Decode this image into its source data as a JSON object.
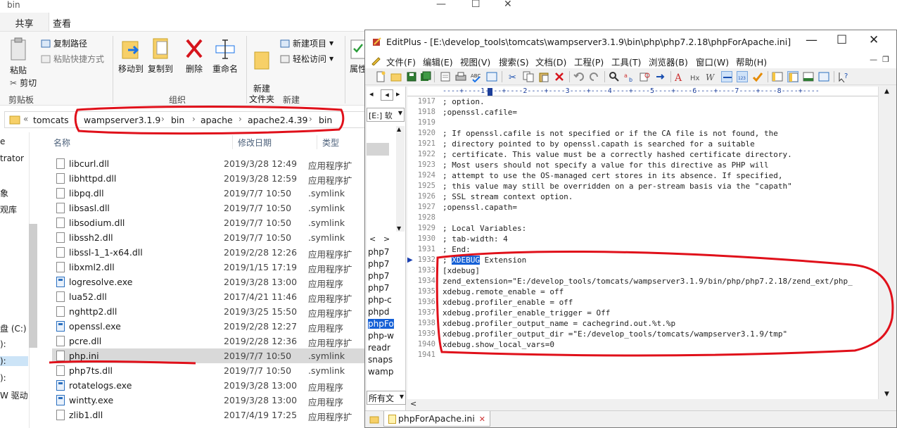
{
  "explorer": {
    "title": "bin",
    "ribbon_tabs": [
      "共享",
      "查看"
    ],
    "ribbon": {
      "paste": "粘贴",
      "copy_path": "复制路径",
      "paste_shortcut": "粘贴快捷方式",
      "cut": "剪切",
      "clipboard_group": "剪贴板",
      "move_to": "移动到",
      "copy_to": "复制到",
      "delete": "删除",
      "rename": "重命名",
      "organize_group": "组织",
      "new_folder": "新建\n文件夹",
      "new_item": "新建项目",
      "easy_access": "轻松访问",
      "new_group": "新建",
      "properties": "属性"
    },
    "breadcrumb": [
      "tomcats",
      "wampserver3.1.9",
      "bin",
      "apache",
      "apache2.4.39",
      "bin"
    ],
    "nav_items": [
      "e",
      "trator",
      "象",
      "观库",
      "盘 (C:)",
      "):",
      "):",
      "):",
      "W 驱动"
    ],
    "columns": {
      "name": "名称",
      "date": "修改日期",
      "type": "类型"
    },
    "files": [
      {
        "name": "libcurl.dll",
        "date": "2019/3/28 12:49",
        "type": "应用程序扩",
        "kind": "dll"
      },
      {
        "name": "libhttpd.dll",
        "date": "2019/3/28 12:59",
        "type": "应用程序扩",
        "kind": "dll"
      },
      {
        "name": "libpq.dll",
        "date": "2019/7/7 10:50",
        "type": ".symlink",
        "kind": "dll"
      },
      {
        "name": "libsasl.dll",
        "date": "2019/7/7 10:50",
        "type": ".symlink",
        "kind": "dll"
      },
      {
        "name": "libsodium.dll",
        "date": "2019/7/7 10:50",
        "type": ".symlink",
        "kind": "dll"
      },
      {
        "name": "libssh2.dll",
        "date": "2019/7/7 10:50",
        "type": ".symlink",
        "kind": "dll"
      },
      {
        "name": "libssl-1_1-x64.dll",
        "date": "2019/2/28 12:26",
        "type": "应用程序扩",
        "kind": "dll"
      },
      {
        "name": "libxml2.dll",
        "date": "2019/1/15 17:19",
        "type": "应用程序扩",
        "kind": "dll"
      },
      {
        "name": "logresolve.exe",
        "date": "2019/3/28 13:00",
        "type": "应用程序",
        "kind": "exe"
      },
      {
        "name": "lua52.dll",
        "date": "2017/4/21 11:46",
        "type": "应用程序扩",
        "kind": "dll"
      },
      {
        "name": "nghttp2.dll",
        "date": "2019/3/25 15:50",
        "type": "应用程序扩",
        "kind": "dll"
      },
      {
        "name": "openssl.exe",
        "date": "2019/2/28 12:27",
        "type": "应用程序",
        "kind": "exe"
      },
      {
        "name": "pcre.dll",
        "date": "2019/2/28 12:36",
        "type": "应用程序扩",
        "kind": "dll"
      },
      {
        "name": "php.ini",
        "date": "2019/7/7 10:50",
        "type": ".symlink",
        "kind": "ini",
        "selected": true
      },
      {
        "name": "php7ts.dll",
        "date": "2019/7/7 10:50",
        "type": ".symlink",
        "kind": "dll"
      },
      {
        "name": "rotatelogs.exe",
        "date": "2019/3/28 13:00",
        "type": "应用程序",
        "kind": "exe"
      },
      {
        "name": "wintty.exe",
        "date": "2019/3/28 13:00",
        "type": "应用程序",
        "kind": "exe"
      },
      {
        "name": "zlib1.dll",
        "date": "2017/4/19 17:25",
        "type": "应用程序扩",
        "kind": "dll"
      }
    ]
  },
  "editplus": {
    "title": "EditPlus - [E:\\develop_tools\\tomcats\\wampserver3.1.9\\bin\\php\\php7.2.18\\phpForApache.ini]",
    "menu": [
      "文件(F)",
      "编辑(E)",
      "视图(V)",
      "搜索(S)",
      "文档(D)",
      "工程(P)",
      "工具(T)",
      "浏览器(B)",
      "窗口(W)",
      "帮助(H)"
    ],
    "drive": "[E:] 软",
    "left_files": [
      "php7",
      "php7",
      "php7",
      "php7",
      "php-c",
      "phpd",
      "phpFo",
      "php-w",
      "readr",
      "snaps",
      "wamp"
    ],
    "filter": "所有文",
    "ruler": "----+----1----+----2----+----3----+----4----+----5----+----6----+----7----+----8----+----",
    "tab_label": "phpForApache.ini",
    "lines": [
      {
        "n": "1917",
        "text": "; option."
      },
      {
        "n": "1918",
        "text": ";openssl.cafile="
      },
      {
        "n": "1919",
        "text": ""
      },
      {
        "n": "1920",
        "text": "; If openssl.cafile is not specified or if the CA file is not found, the"
      },
      {
        "n": "1921",
        "text": "; directory pointed to by openssl.capath is searched for a suitable"
      },
      {
        "n": "1922",
        "text": "; certificate. This value must be a correctly hashed certificate directory."
      },
      {
        "n": "1923",
        "text": "; Most users should not specify a value for this directive as PHP will"
      },
      {
        "n": "1924",
        "text": "; attempt to use the OS-managed cert stores in its absence. If specified,"
      },
      {
        "n": "1925",
        "text": "; this value may still be overridden on a per-stream basis via the \"capath\""
      },
      {
        "n": "1926",
        "text": "; SSL stream context option."
      },
      {
        "n": "1927",
        "text": ";openssl.capath="
      },
      {
        "n": "1928",
        "text": ""
      },
      {
        "n": "1929",
        "text": "; Local Variables:"
      },
      {
        "n": "1930",
        "text": "; tab-width: 4"
      },
      {
        "n": "1931",
        "text": "; End:"
      },
      {
        "n": "1932",
        "text_pre": "; ",
        "highlight": "XDEBUG",
        "text_post": " Extension"
      },
      {
        "n": "1933",
        "text": "[xdebug]"
      },
      {
        "n": "1934",
        "text": "zend_extension=\"E:/develop_tools/tomcats/wampserver3.1.9/bin/php/php7.2.18/zend_ext/php_"
      },
      {
        "n": "1935",
        "text": "xdebug.remote_enable = off"
      },
      {
        "n": "1936",
        "text": "xdebug.profiler_enable = off"
      },
      {
        "n": "1937",
        "text": "xdebug.profiler_enable_trigger = Off"
      },
      {
        "n": "1938",
        "text": "xdebug.profiler_output_name = cachegrind.out.%t.%p"
      },
      {
        "n": "1939",
        "text": "xdebug.profiler_output_dir =\"E:/develop_tools/tomcats/wampserver3.1.9/tmp\""
      },
      {
        "n": "1940",
        "text": "xdebug.show_local_vars=0"
      },
      {
        "n": "1941",
        "text": ""
      }
    ]
  },
  "colors": {
    "annotation_red": "#e0101a",
    "selection_blue": "#1560d6"
  }
}
